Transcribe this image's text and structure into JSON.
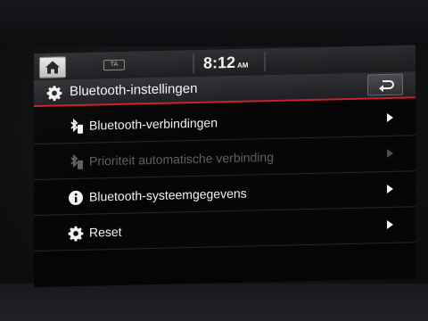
{
  "status_bar": {
    "radio_badge": "TA",
    "time": "8:12",
    "ampm": "AM"
  },
  "header": {
    "title": "Bluetooth-instellingen",
    "icon": "gear-icon",
    "back_icon": "return-arrow-icon"
  },
  "menu": {
    "items": [
      {
        "label": "Bluetooth-verbindingen",
        "icon": "bluetooth-phone-icon",
        "enabled": true
      },
      {
        "label": "Prioriteit automatische verbinding",
        "icon": "bluetooth-phone-icon",
        "enabled": false
      },
      {
        "label": "Bluetooth-systeemgegevens",
        "icon": "info-icon",
        "enabled": true
      },
      {
        "label": "Reset",
        "icon": "gear-icon",
        "enabled": true
      }
    ]
  },
  "colors": {
    "accent_line": "#c8232c",
    "text": "#f2f2f2",
    "disabled_text": "#5e6064"
  }
}
